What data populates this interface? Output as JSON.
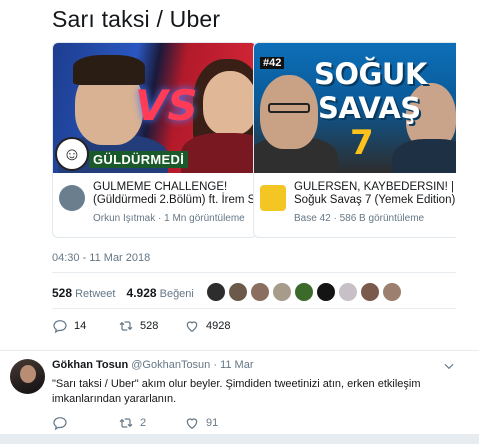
{
  "tweet": {
    "text": "Sarı taksi / Uber",
    "cards": [
      {
        "thumbnail_text": "GÜLDÜRMEDİ",
        "thumbnail_overlay": "VS",
        "title_line1": "GÜLMEME CHALLENGE!",
        "title_line2": "(Güldürmedi 2.Bölüm) ft. İrem S",
        "channel": "Orkun Işıtmak",
        "views": "1 Mn görüntüleme"
      },
      {
        "thumbnail_ep": "#42",
        "thumbnail_line1": "SOĞUK",
        "thumbnail_line2": "SAVAŞ",
        "thumbnail_num": "7",
        "title_line1": "GÜLERSEN, KAYBEDERSİN! |",
        "title_line2": "Soğuk Savaş 7 (Yemek Edition) ...",
        "channel": "Base 42",
        "views": "586 B görüntüleme"
      }
    ],
    "timestamp": "04:30 - 11 Mar 2018",
    "retweets_count": "528",
    "retweets_label": "Retweet",
    "likes_count": "4.928",
    "likes_label": "Beğeni",
    "actions": {
      "reply_count": "14",
      "retweet_count": "528",
      "like_count": "4928"
    },
    "liker_colors": [
      "#2d2d2d",
      "#6b5a4a",
      "#8a6e60",
      "#a79c8c",
      "#3b6a2a",
      "#141414",
      "#c7c0c6",
      "#7a5a4c",
      "#9d7f70"
    ]
  },
  "reply": {
    "name": "Gökhan Tosun",
    "handle": "@GokhanTosun",
    "date": "· 11 Mar",
    "text_line1": "\"Sarı taksi / Uber\" akım olur beyler. Şimdiden tweetinizi atın, erken etkileşim",
    "text_line2": "imkanlarından yararlanın.",
    "actions": {
      "reply_count": "",
      "retweet_count": "2",
      "like_count": "91"
    }
  },
  "colors": {
    "text": "#14171a",
    "muted": "#657786",
    "border": "#e6ecf0"
  }
}
